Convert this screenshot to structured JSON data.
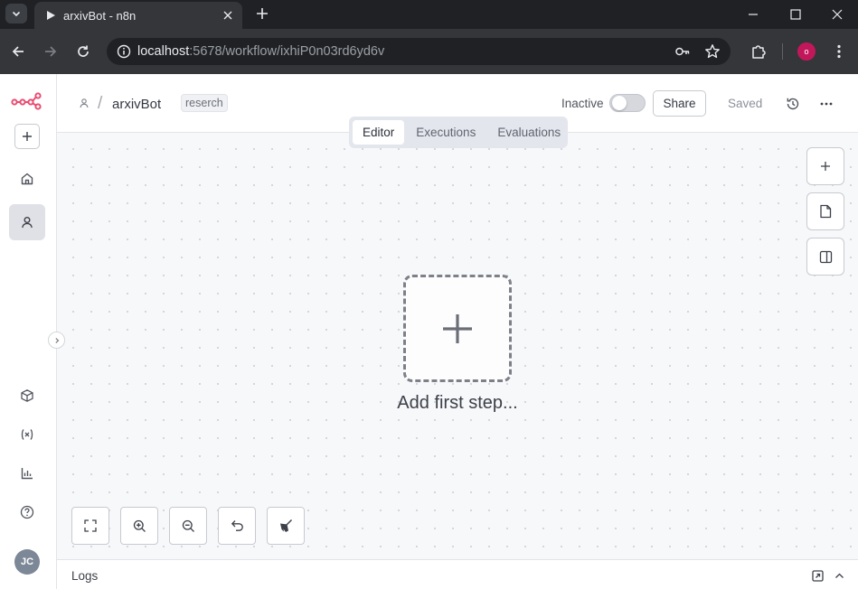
{
  "browser": {
    "tab_title": "arxivBot - n8n",
    "url_host": "localhost",
    "url_path": ":5678/workflow/ixhiP0n03rd6yd6v",
    "profile_initial": "o"
  },
  "header": {
    "workflow_name": "arxivBot",
    "tag": "reserch",
    "status_label": "Inactive",
    "active": false,
    "share_label": "Share",
    "saved_label": "Saved"
  },
  "view_tabs": [
    {
      "label": "Editor",
      "active": true
    },
    {
      "label": "Executions",
      "active": false
    },
    {
      "label": "Evaluations",
      "active": false
    }
  ],
  "canvas": {
    "add_first_step_label": "Add first step..."
  },
  "sidebar": {
    "user_initials": "JC"
  },
  "logs": {
    "label": "Logs"
  },
  "colors": {
    "brand": "#ea4b71",
    "profile": "#c2185b"
  }
}
